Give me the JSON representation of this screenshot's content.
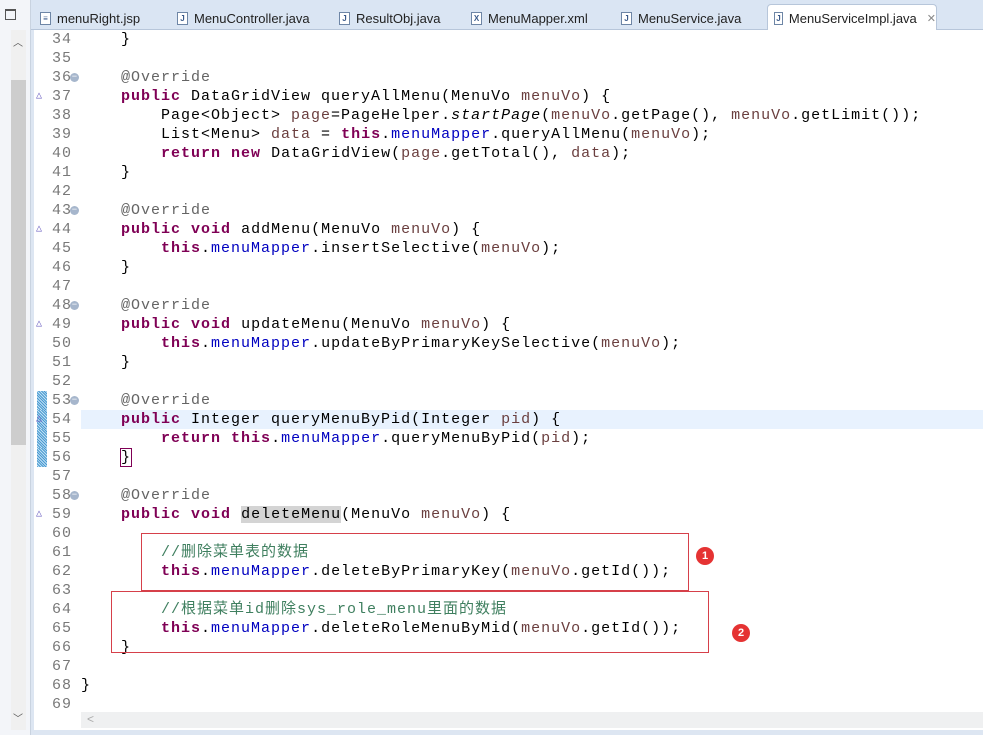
{
  "tabs": [
    {
      "label": "menuRight.jsp",
      "icon": "jsp-file-icon",
      "glyph": "≡"
    },
    {
      "label": "MenuController.java",
      "icon": "java-file-icon",
      "glyph": "J"
    },
    {
      "label": "ResultObj.java",
      "icon": "java-file-icon",
      "glyph": "J"
    },
    {
      "label": "MenuMapper.xml",
      "icon": "xml-file-icon",
      "glyph": "X"
    },
    {
      "label": "MenuService.java",
      "icon": "java-file-icon",
      "glyph": "J"
    },
    {
      "label": "MenuServiceImpl.java",
      "icon": "java-file-icon",
      "glyph": "J",
      "active": true,
      "close": "✕"
    }
  ],
  "annotations": {
    "badge1": "1",
    "badge2": "2",
    "box_color": "#d6404a",
    "badge_color": "#e53333"
  },
  "current_line": 54,
  "lines": [
    {
      "n": "34",
      "seg": [
        [
          "    }",
          ""
        ]
      ]
    },
    {
      "n": "35",
      "seg": []
    },
    {
      "n": "36",
      "fold": true,
      "seg": [
        [
          "    ",
          ""
        ],
        [
          "@Override",
          "ann"
        ]
      ]
    },
    {
      "n": "37",
      "override": true,
      "seg": [
        [
          "    ",
          ""
        ],
        [
          "public",
          "kw"
        ],
        [
          " DataGridView queryAllMenu(MenuVo ",
          ""
        ],
        [
          "menuVo",
          "var"
        ],
        [
          ") {",
          ""
        ]
      ]
    },
    {
      "n": "38",
      "seg": [
        [
          "        Page<Object> ",
          ""
        ],
        [
          "page",
          "var"
        ],
        [
          "=PageHelper.",
          ""
        ],
        [
          "startPage",
          "it"
        ],
        [
          "(",
          ""
        ],
        [
          "menuVo",
          "var"
        ],
        [
          ".getPage(), ",
          ""
        ],
        [
          "menuVo",
          "var"
        ],
        [
          ".getLimit());",
          ""
        ]
      ]
    },
    {
      "n": "39",
      "seg": [
        [
          "        List<Menu> ",
          ""
        ],
        [
          "data",
          "var"
        ],
        [
          " = ",
          ""
        ],
        [
          "this",
          "kw"
        ],
        [
          ".",
          ""
        ],
        [
          "menuMapper",
          "fld"
        ],
        [
          ".queryAllMenu(",
          ""
        ],
        [
          "menuVo",
          "var"
        ],
        [
          ");",
          ""
        ]
      ]
    },
    {
      "n": "40",
      "seg": [
        [
          "        ",
          ""
        ],
        [
          "return",
          "kw"
        ],
        [
          " ",
          ""
        ],
        [
          "new",
          "kw"
        ],
        [
          " DataGridView(",
          ""
        ],
        [
          "page",
          "var"
        ],
        [
          ".getTotal(), ",
          ""
        ],
        [
          "data",
          "var"
        ],
        [
          ");",
          ""
        ]
      ]
    },
    {
      "n": "41",
      "seg": [
        [
          "    }",
          ""
        ]
      ]
    },
    {
      "n": "42",
      "seg": []
    },
    {
      "n": "43",
      "fold": true,
      "seg": [
        [
          "    ",
          ""
        ],
        [
          "@Override",
          "ann"
        ]
      ]
    },
    {
      "n": "44",
      "override": true,
      "seg": [
        [
          "    ",
          ""
        ],
        [
          "public",
          "kw"
        ],
        [
          " ",
          ""
        ],
        [
          "void",
          "kw"
        ],
        [
          " addMenu(MenuVo ",
          ""
        ],
        [
          "menuVo",
          "var"
        ],
        [
          ") {",
          ""
        ]
      ]
    },
    {
      "n": "45",
      "seg": [
        [
          "        ",
          ""
        ],
        [
          "this",
          "kw"
        ],
        [
          ".",
          ""
        ],
        [
          "menuMapper",
          "fld"
        ],
        [
          ".insertSelective(",
          ""
        ],
        [
          "menuVo",
          "var"
        ],
        [
          ");",
          ""
        ]
      ]
    },
    {
      "n": "46",
      "seg": [
        [
          "    }",
          ""
        ]
      ]
    },
    {
      "n": "47",
      "seg": []
    },
    {
      "n": "48",
      "fold": true,
      "seg": [
        [
          "    ",
          ""
        ],
        [
          "@Override",
          "ann"
        ]
      ]
    },
    {
      "n": "49",
      "override": true,
      "seg": [
        [
          "    ",
          ""
        ],
        [
          "public",
          "kw"
        ],
        [
          " ",
          ""
        ],
        [
          "void",
          "kw"
        ],
        [
          " updateMenu(MenuVo ",
          ""
        ],
        [
          "menuVo",
          "var"
        ],
        [
          ") {",
          ""
        ]
      ]
    },
    {
      "n": "50",
      "seg": [
        [
          "        ",
          ""
        ],
        [
          "this",
          "kw"
        ],
        [
          ".",
          ""
        ],
        [
          "menuMapper",
          "fld"
        ],
        [
          ".updateByPrimaryKeySelective(",
          ""
        ],
        [
          "menuVo",
          "var"
        ],
        [
          ");",
          ""
        ]
      ]
    },
    {
      "n": "51",
      "seg": [
        [
          "    }",
          ""
        ]
      ]
    },
    {
      "n": "52",
      "seg": []
    },
    {
      "n": "53",
      "fold": true,
      "sel": true,
      "seg": [
        [
          "    ",
          ""
        ],
        [
          "@Override",
          "ann"
        ]
      ]
    },
    {
      "n": "54",
      "override": true,
      "sel": true,
      "seg": [
        [
          "    ",
          ""
        ],
        [
          "public",
          "kw"
        ],
        [
          " Integer queryMenuByPid(Integer ",
          ""
        ],
        [
          "pid",
          "var"
        ],
        [
          ") {",
          ""
        ]
      ]
    },
    {
      "n": "55",
      "sel": true,
      "seg": [
        [
          "        ",
          ""
        ],
        [
          "return",
          "kw"
        ],
        [
          " ",
          ""
        ],
        [
          "this",
          "kw"
        ],
        [
          ".",
          ""
        ],
        [
          "menuMapper",
          "fld"
        ],
        [
          ".queryMenuByPid(",
          ""
        ],
        [
          "pid",
          "var"
        ],
        [
          ");",
          ""
        ]
      ]
    },
    {
      "n": "56",
      "sel": true,
      "seg": [
        [
          "    ",
          ""
        ],
        [
          "}",
          "br"
        ]
      ]
    },
    {
      "n": "57",
      "seg": []
    },
    {
      "n": "58",
      "fold": true,
      "seg": [
        [
          "    ",
          ""
        ],
        [
          "@Override",
          "ann"
        ]
      ]
    },
    {
      "n": "59",
      "override": true,
      "seg": [
        [
          "    ",
          ""
        ],
        [
          "public",
          "kw"
        ],
        [
          " ",
          ""
        ],
        [
          "void",
          "kw"
        ],
        [
          " ",
          ""
        ],
        [
          "deleteMenu",
          "hl"
        ],
        [
          "(MenuVo ",
          ""
        ],
        [
          "menuVo",
          "var"
        ],
        [
          ") {",
          ""
        ]
      ]
    },
    {
      "n": "60",
      "seg": []
    },
    {
      "n": "61",
      "seg": [
        [
          "        ",
          ""
        ],
        [
          "//删除菜单表的数据",
          "cm"
        ]
      ]
    },
    {
      "n": "62",
      "seg": [
        [
          "        ",
          ""
        ],
        [
          "this",
          "kw"
        ],
        [
          ".",
          ""
        ],
        [
          "menuMapper",
          "fld"
        ],
        [
          ".deleteByPrimaryKey(",
          ""
        ],
        [
          "menuVo",
          "var"
        ],
        [
          ".getId());",
          ""
        ]
      ]
    },
    {
      "n": "63",
      "seg": []
    },
    {
      "n": "64",
      "seg": [
        [
          "        ",
          ""
        ],
        [
          "//根据菜单id删除sys_role_menu里面的数据",
          "cm"
        ]
      ]
    },
    {
      "n": "65",
      "seg": [
        [
          "        ",
          ""
        ],
        [
          "this",
          "kw"
        ],
        [
          ".",
          ""
        ],
        [
          "menuMapper",
          "fld"
        ],
        [
          ".deleteRoleMenuByMid(",
          ""
        ],
        [
          "menuVo",
          "var"
        ],
        [
          ".getId());",
          ""
        ]
      ]
    },
    {
      "n": "66",
      "seg": [
        [
          "    }",
          ""
        ]
      ]
    },
    {
      "n": "67",
      "seg": []
    },
    {
      "n": "68",
      "seg": [
        [
          "}",
          ""
        ]
      ]
    },
    {
      "n": "69",
      "seg": []
    }
  ]
}
